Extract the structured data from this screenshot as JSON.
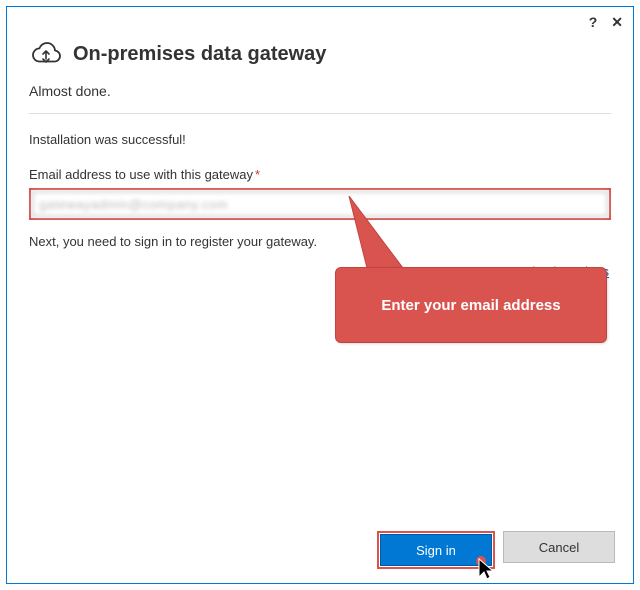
{
  "title": "On-premises data gateway",
  "subtitle": "Almost done.",
  "success_message": "Installation was successful!",
  "email_label": "Email address to use with this gateway",
  "required_marker": "*",
  "email_value": "gatewayadmin@company.com",
  "next_instruction": "Next, you need to sign in to register your gateway.",
  "signin_options_label": "Sign in options",
  "callout_text": "Enter your email address",
  "buttons": {
    "signin": "Sign in",
    "cancel": "Cancel"
  },
  "titlebar": {
    "help": "?",
    "close": "✕"
  }
}
